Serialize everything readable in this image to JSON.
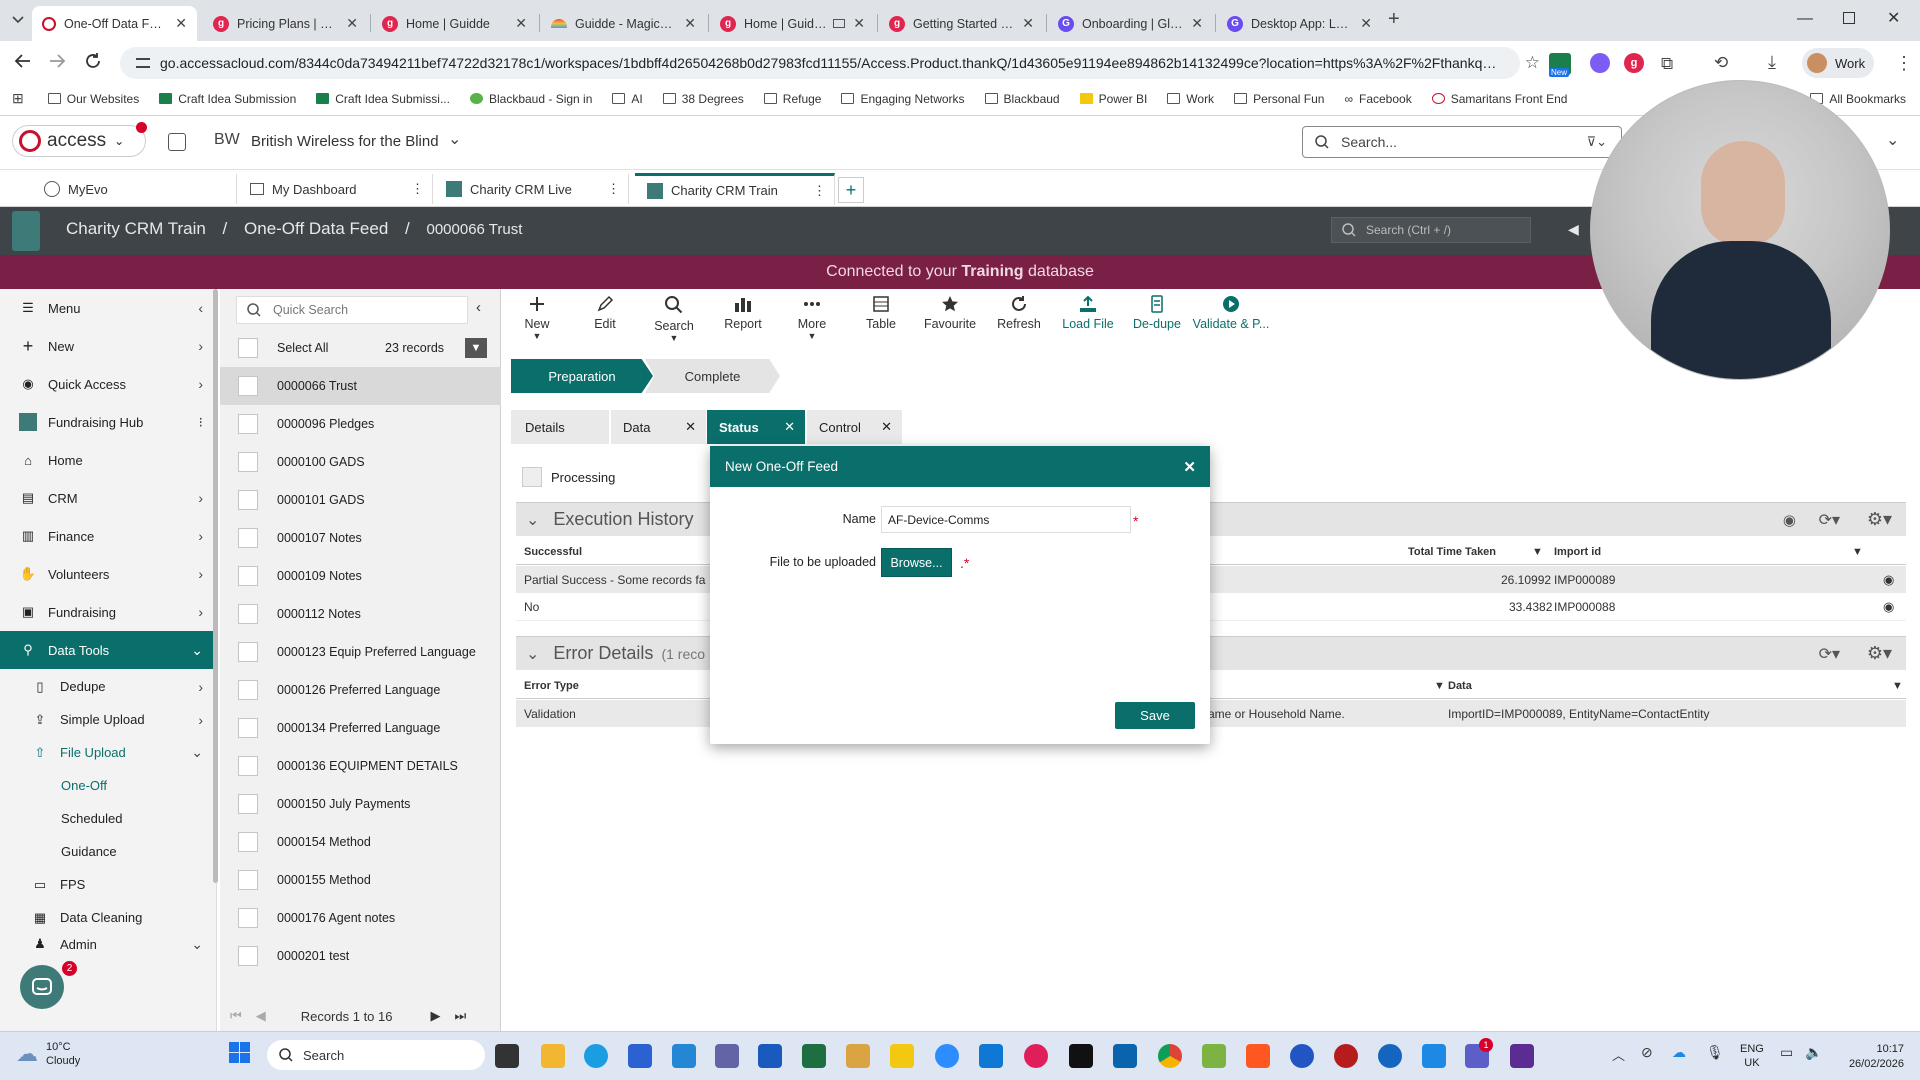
{
  "browser": {
    "tabs": [
      {
        "title": "One-Off Data Feed | Char",
        "favicon": "access-icon",
        "color": "#c8102e",
        "active": true
      },
      {
        "title": "Pricing Plans | Guidde",
        "favicon": "guidde-icon",
        "color": "#e0264f"
      },
      {
        "title": "Home | Guidde",
        "favicon": "guidde-icon",
        "color": "#e0264f"
      },
      {
        "title": "Guidde - Magically create",
        "favicon": "rainbow-icon",
        "color": "#f29b30"
      },
      {
        "title": "Home | Guidde",
        "favicon": "guidde-icon",
        "color": "#e0264f"
      },
      {
        "title": "Getting Started with Capt",
        "favicon": "guidde-icon",
        "color": "#e0264f"
      },
      {
        "title": "Onboarding | Glitter AI",
        "favicon": "glitter-icon",
        "color": "#6a4cf0"
      },
      {
        "title": "Desktop App: Login | Glitt",
        "favicon": "glitter-icon",
        "color": "#6a4cf0"
      }
    ],
    "url": "go.accessacloud.com/8344c0da73494211bef74722d32178c1/workspaces/1bdbff4d26504268b0d27983fcd11155/Access.Product.thankQ/1d43605e91194ee894862b14132499ce?location=https%3A%2F%2Fthankqbli...",
    "new_badge": "New",
    "profile_label": "Work",
    "bookmarks": [
      "Our Websites",
      "Craft Idea Submission",
      "Craft Idea Submissi...",
      "Blackbaud - Sign in",
      "AI",
      "38 Degrees",
      "Refuge",
      "Engaging Networks",
      "Blackbaud",
      "Power BI",
      "Work",
      "Personal Fun",
      "Facebook",
      "Samaritans Front End"
    ],
    "all_bookmarks": "All Bookmarks"
  },
  "app": {
    "logo_text": "access",
    "org_initials": "BW",
    "org_name": "British Wireless for the Blind",
    "search_placeholder": "Search...",
    "workspace_tabs": [
      {
        "label": "MyEvo"
      },
      {
        "label": "My Dashboard"
      },
      {
        "label": "Charity CRM Live"
      },
      {
        "label": "Charity CRM Train",
        "active": true
      }
    ],
    "breadcrumb": [
      "Charity CRM Train",
      "One-Off Data Feed",
      "0000066 Trust"
    ],
    "crumb_search_placeholder": "Search (Ctrl + /)",
    "banner_prefix": "Connected to your ",
    "banner_db": "Training",
    "banner_suffix": " database"
  },
  "sidebar": {
    "items": [
      {
        "label": "Menu",
        "icon": "menu-icon"
      },
      {
        "label": "New",
        "icon": "plus-icon"
      },
      {
        "label": "Quick Access",
        "icon": "eye-icon"
      },
      {
        "label": "Fundraising Hub",
        "icon": "hub-icon"
      },
      {
        "label": "Home",
        "icon": "home-icon"
      },
      {
        "label": "CRM",
        "icon": "crm-icon"
      },
      {
        "label": "Finance",
        "icon": "finance-icon"
      },
      {
        "label": "Volunteers",
        "icon": "volunteers-icon"
      },
      {
        "label": "Fundraising",
        "icon": "fundraising-icon"
      },
      {
        "label": "Data Tools",
        "icon": "data-tools-icon"
      },
      {
        "label": "Dedupe",
        "icon": "dedupe-icon"
      },
      {
        "label": "Simple Upload",
        "icon": "upload-icon"
      },
      {
        "label": "File Upload",
        "icon": "file-upload-icon"
      },
      {
        "label": "One-Off"
      },
      {
        "label": "Scheduled"
      },
      {
        "label": "Guidance"
      },
      {
        "label": "FPS",
        "icon": "fps-icon"
      },
      {
        "label": "Data Cleaning",
        "icon": "cleaning-icon"
      },
      {
        "label": "Admin",
        "icon": "admin-icon"
      }
    ],
    "chat_badge": "2"
  },
  "list": {
    "search_placeholder": "Quick Search",
    "select_all": "Select All",
    "count": "23 records",
    "rows": [
      "0000066 Trust",
      "0000096 Pledges",
      "0000100 GADS",
      "0000101 GADS",
      "0000107 Notes",
      "0000109 Notes",
      "0000112 Notes",
      "0000123 Equip Preferred Language",
      "0000126 Preferred Language",
      "0000134 Preferred Language",
      "0000136 EQUIPMENT DETAILS",
      "0000150 July Payments",
      "0000154 Method",
      "0000155 Method",
      "0000176 Agent notes",
      "0000201 test"
    ],
    "pager": "Records 1 to 16"
  },
  "toolbar": [
    "New",
    "Edit",
    "Search",
    "Report",
    "More",
    "Table",
    "Favourite",
    "Refresh",
    "Load File",
    "De-dupe",
    "Validate & P..."
  ],
  "steps": [
    "Preparation",
    "Complete"
  ],
  "detail_tabs": [
    "Details",
    "Data",
    "Status",
    "Control"
  ],
  "status": {
    "processing_label": "Processing",
    "execution_title": "Execution History",
    "exec_columns": [
      "Successful",
      "Total Time Taken",
      "Import id"
    ],
    "exec_rows": [
      {
        "successful": "Partial Success - Some records fa",
        "time": "26.10992",
        "import_id": "IMP000089"
      },
      {
        "successful": "No",
        "time": "33.4382",
        "import_id": "IMP000088"
      }
    ],
    "error_title": "Error Details",
    "error_count": "(1 reco",
    "error_columns": [
      "Error Type",
      "Data"
    ],
    "error_rows": [
      {
        "type": "Validation",
        "message": "ame or Household Name.",
        "data": "ImportID=IMP000089, EntityName=ContactEntity"
      }
    ]
  },
  "modal": {
    "title": "New One-Off Feed",
    "name_label": "Name",
    "name_value": "AF-Device-Comms",
    "file_label": "File to be uploaded",
    "browse_label": "Browse...",
    "save_label": "Save"
  },
  "taskbar": {
    "weather_temp": "10°C",
    "weather_desc": "Cloudy",
    "search_placeholder": "Search",
    "lang_top": "ENG",
    "lang_bottom": "UK",
    "time": "10:17",
    "date": "26/02/2026",
    "teams_badge": "1"
  },
  "colors": {
    "teal": "#0a6f6b",
    "banner": "#7a1f45",
    "crumb_bar": "#3e4447"
  }
}
